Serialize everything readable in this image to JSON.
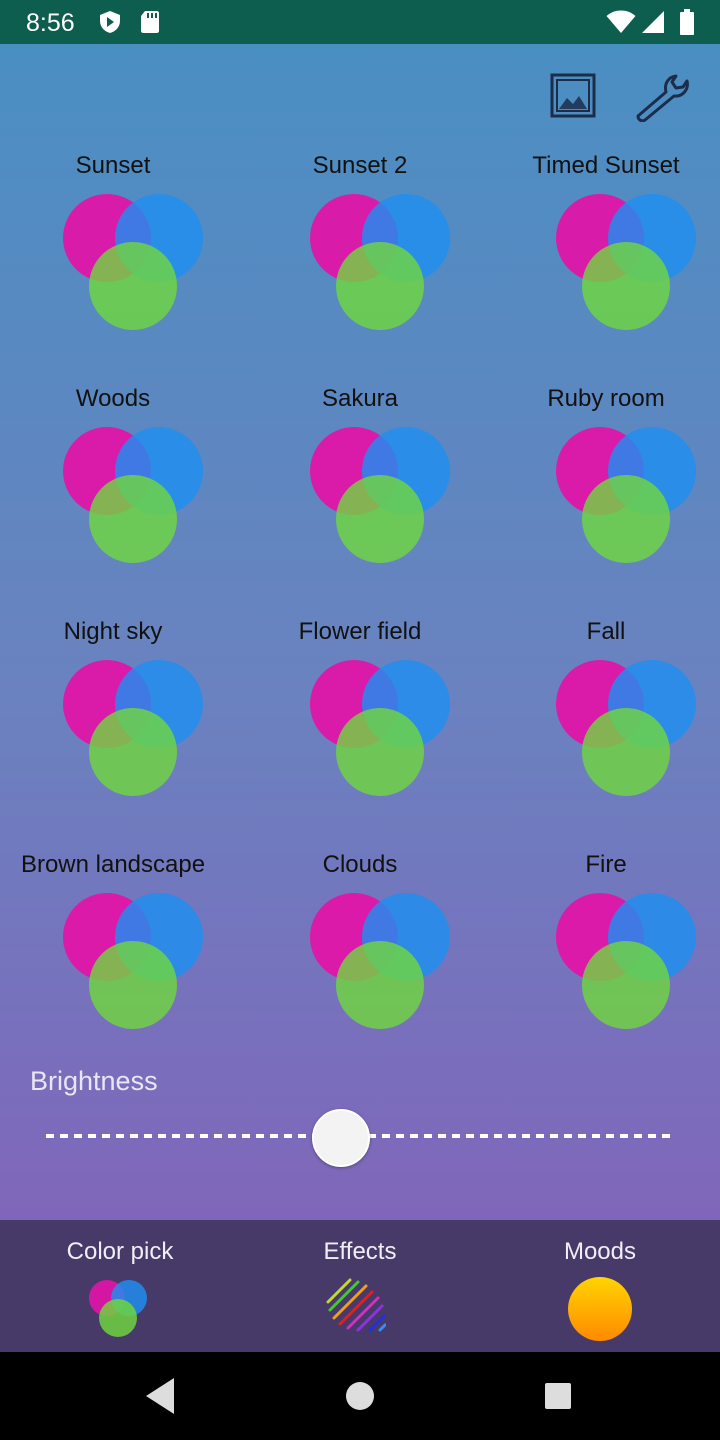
{
  "status_bar": {
    "time": "8:56",
    "icons": [
      "shield-icon",
      "sd-card-icon",
      "wifi-icon",
      "cell-signal-icon",
      "battery-icon"
    ]
  },
  "toolbar": {
    "icons": [
      "image-icon",
      "wrench-icon"
    ]
  },
  "moods": [
    {
      "label": "Sunset"
    },
    {
      "label": "Sunset 2"
    },
    {
      "label": "Timed Sunset"
    },
    {
      "label": "Woods"
    },
    {
      "label": "Sakura"
    },
    {
      "label": "Ruby room"
    },
    {
      "label": "Night sky"
    },
    {
      "label": "Flower field"
    },
    {
      "label": "Fall"
    },
    {
      "label": "Brown landscape"
    },
    {
      "label": "Clouds"
    },
    {
      "label": "Fire"
    }
  ],
  "brightness": {
    "label": "Brightness",
    "value": 0.47
  },
  "bottom_nav": {
    "items": [
      {
        "label": "Color pick",
        "icon": "color-circles-icon"
      },
      {
        "label": "Effects",
        "icon": "rainbow-stripes-icon"
      },
      {
        "label": "Moods",
        "icon": "sun-orb-icon"
      }
    ]
  },
  "colors": {
    "status_bar": "#0d5e4e",
    "gradient_top": "#4a8fc2",
    "gradient_bottom": "#8066ba",
    "bottom_nav": "#483a68",
    "circle_magenta": "#e015a8",
    "circle_blue": "#1f8ff0",
    "circle_green": "#6fd83c"
  }
}
